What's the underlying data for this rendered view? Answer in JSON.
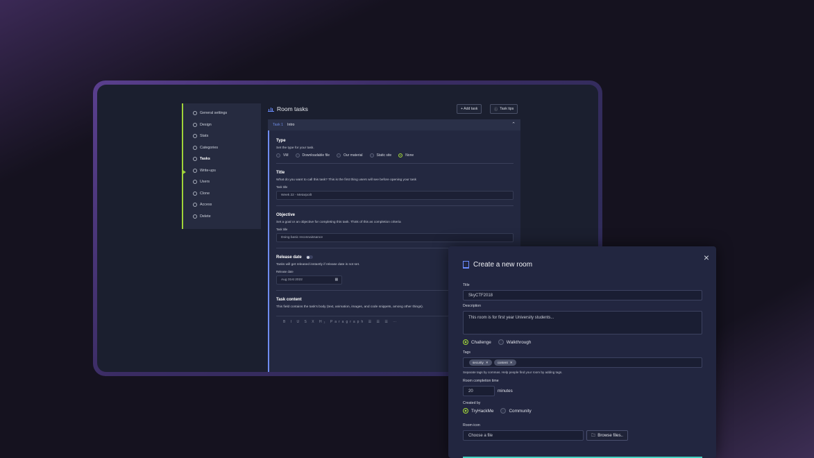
{
  "sidebar": {
    "items": [
      {
        "label": "General settings",
        "icon": "gear-icon"
      },
      {
        "label": "Design",
        "icon": "palette-icon"
      },
      {
        "label": "Stats",
        "icon": "chart-icon"
      },
      {
        "label": "Categories",
        "icon": "tag-icon"
      },
      {
        "label": "Tasks",
        "icon": "list-icon",
        "active": true
      },
      {
        "label": "Write-ups",
        "icon": "pen-icon"
      },
      {
        "label": "Users",
        "icon": "users-icon"
      },
      {
        "label": "Clone",
        "icon": "copy-icon"
      },
      {
        "label": "Access",
        "icon": "lock-icon"
      },
      {
        "label": "Delete",
        "icon": "trash-icon"
      }
    ],
    "accent": "#9fd339"
  },
  "tasks": {
    "title": "Room tasks",
    "add_task": "+ Add task",
    "task_tips": "Task tips",
    "task_label": "Task 1",
    "task_name": "Intro",
    "type": {
      "heading": "Type",
      "desc": "Set the type for your task.",
      "options": [
        "VM",
        "Downloadable file",
        "Our material",
        "Static site",
        "None"
      ],
      "selected": "None"
    },
    "title_section": {
      "heading": "Title",
      "desc": "What do you want to call this task? This is the first thing users will see before opening your task",
      "field_label": "Task title",
      "value": "Week 22 - Metarpoilt"
    },
    "objective": {
      "heading": "Objective",
      "desc": "Set a goal or an objective for completing this task. Think of this as completion criteria",
      "field_label": "Task title",
      "value": "Doing basic reconnaissance"
    },
    "release": {
      "heading": "Release date",
      "desc": "Tasks will get released instantly if release date is not set.",
      "field_label": "Release date",
      "value": "Aug 31st 2022"
    },
    "content": {
      "heading": "Task content",
      "desc": "This field contains the task's body (text, animation, images, and code snippets, among other things).",
      "toolbar": "B I U S X H₂ Paragraph  ☰ ☰ ☰ ⋯"
    }
  },
  "modal": {
    "title": "Create a new room",
    "close": "×",
    "title_label": "Title",
    "title_value": "SkyCTF2018",
    "description_label": "Description",
    "description_value": "This room is for first year University students...",
    "room_types": [
      "Challenge",
      "Walkthrough"
    ],
    "room_type_selected": "Challenge",
    "tags_label": "Tags",
    "tags": [
      "security",
      "content"
    ],
    "tags_hint": "Separate tags by commas. Help people find your room by adding tags.",
    "completion_label": "Room completion time",
    "completion_value": "20",
    "completion_unit": "minutes",
    "created_by_label": "Created by",
    "created_by_options": [
      "TryHackMe",
      "Community"
    ],
    "created_by_selected": "TryHackMe",
    "icon_label": "Room icon",
    "icon_placeholder": "Choose a file",
    "browse_label": "Browse files..",
    "accent": "#6b8cff"
  }
}
